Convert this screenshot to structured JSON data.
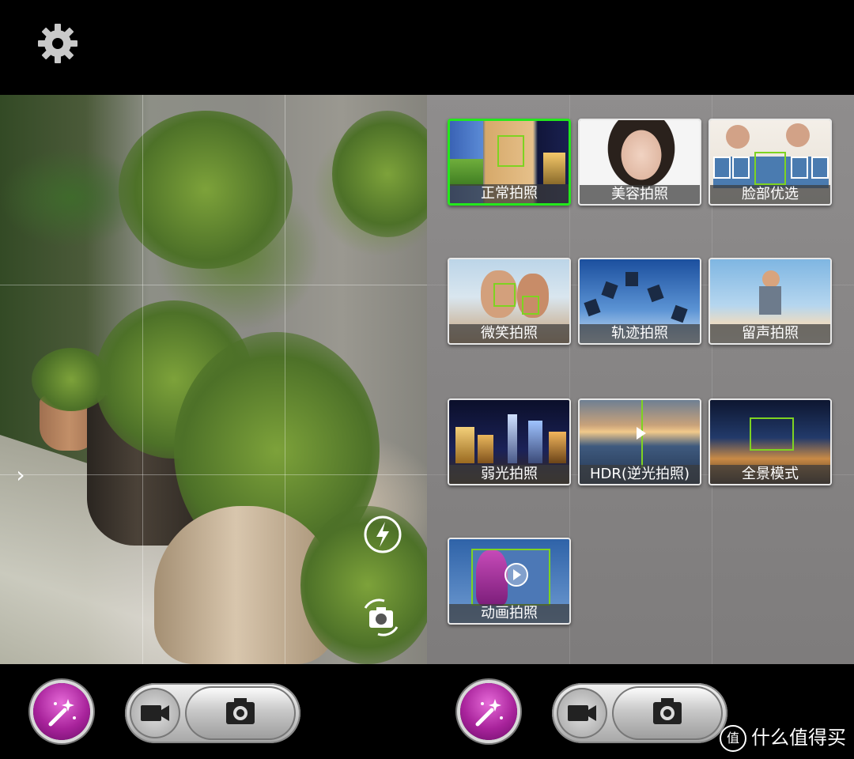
{
  "top": {
    "settings_icon": "gear-icon"
  },
  "viewfinder": {
    "expand_icon": "chevron-right-icon",
    "flash_icon": "flash-auto-icon",
    "switch_camera_icon": "switch-camera-icon"
  },
  "modes": [
    {
      "label": "正常拍照",
      "selected": true
    },
    {
      "label": "美容拍照",
      "selected": false
    },
    {
      "label": "脸部优选",
      "selected": false
    },
    {
      "label": "微笑拍照",
      "selected": false
    },
    {
      "label": "轨迹拍照",
      "selected": false
    },
    {
      "label": "留声拍照",
      "selected": false
    },
    {
      "label": "弱光拍照",
      "selected": false
    },
    {
      "label": "HDR(逆光拍照)",
      "selected": false
    },
    {
      "label": "全景模式",
      "selected": false
    },
    {
      "label": "动画拍照",
      "selected": false
    }
  ],
  "controls": {
    "effects_icon": "magic-wand-icon",
    "video_icon": "video-camera-icon",
    "shutter_icon": "camera-icon"
  },
  "watermark": {
    "icon_text": "值",
    "text": "什么值得买"
  },
  "colors": {
    "selected_border": "#24e81c",
    "face_box": "#7ed321",
    "effects_button": "#a8239b"
  }
}
